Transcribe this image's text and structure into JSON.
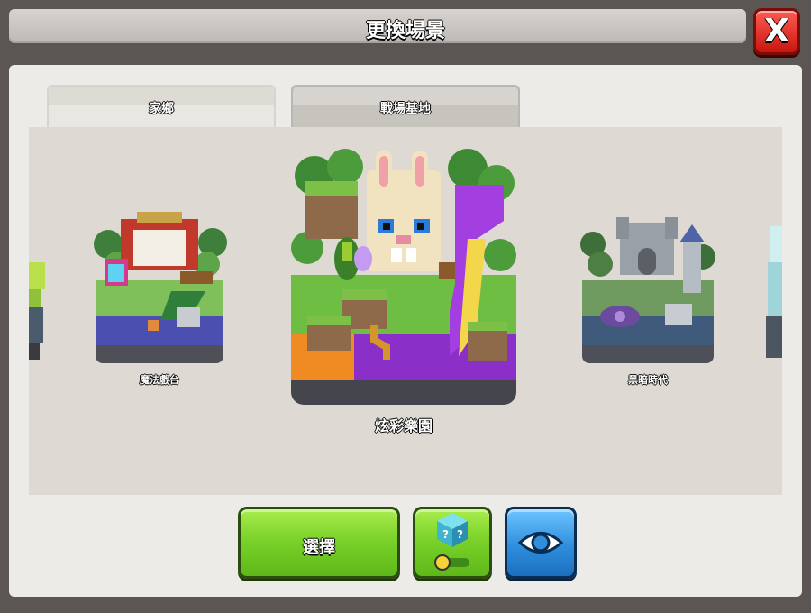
{
  "window": {
    "title": "更換場景",
    "close_label": "X"
  },
  "tabs": [
    {
      "label": "家鄉",
      "active": true
    },
    {
      "label": "戰場基地",
      "active": false
    }
  ],
  "scenery": {
    "items": [
      {
        "name": "",
        "partial": true
      },
      {
        "name": "魔法戲台"
      },
      {
        "name": "炫彩樂園",
        "selected": true
      },
      {
        "name": "黑暗時代"
      },
      {
        "name": "",
        "partial": true
      }
    ]
  },
  "buttons": {
    "select_label": "選擇",
    "random_icon": "question-cube-icon",
    "toggle_icon": "toggle-icon",
    "preview_icon": "eye-icon"
  },
  "colors": {
    "select_button": "#7bd22a",
    "preview_button": "#2f8fdd",
    "close_button": "#e0261c"
  }
}
